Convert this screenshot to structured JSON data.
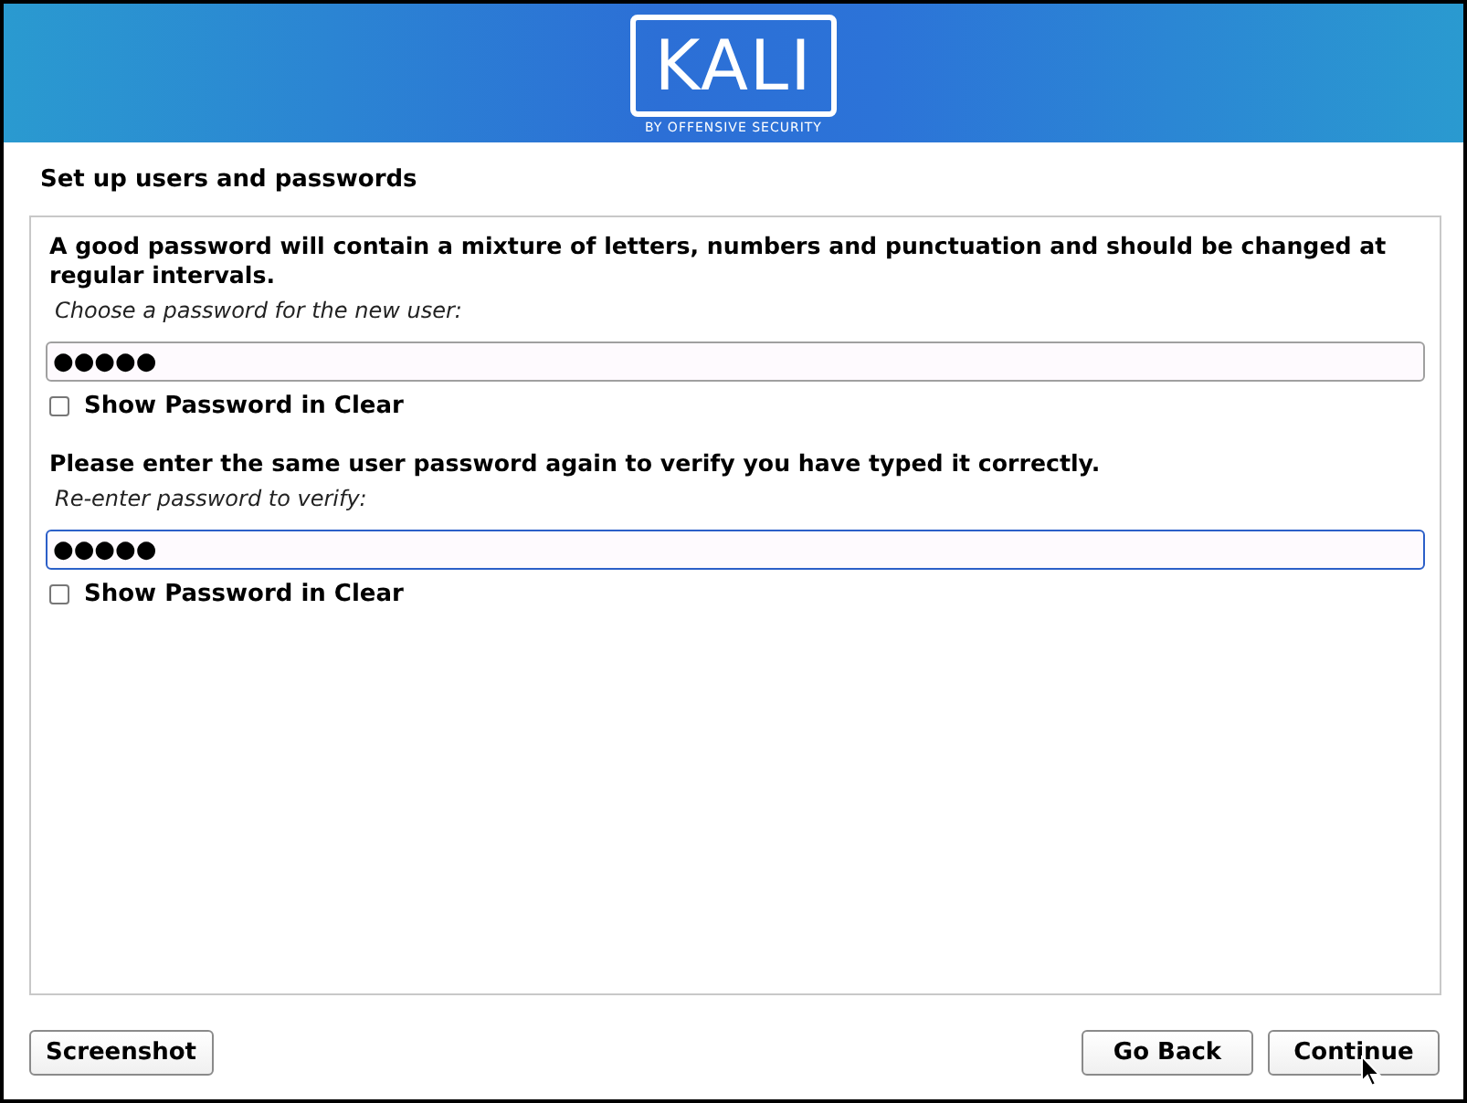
{
  "header": {
    "logo_text": "KALI",
    "logo_tagline": "BY OFFENSIVE SECURITY"
  },
  "page_title": "Set up users and passwords",
  "sections": [
    {
      "description": "A good password will contain a mixture of letters, numbers and punctuation and should be changed at regular intervals.",
      "prompt": "Choose a password for the new user:",
      "value": "●●●●●",
      "focused": false,
      "show_clear": {
        "label": "Show Password in Clear",
        "checked": false
      }
    },
    {
      "description": "Please enter the same user password again to verify you have typed it correctly.",
      "prompt": "Re-enter password to verify:",
      "value": "●●●●●",
      "focused": true,
      "show_clear": {
        "label": "Show Password in Clear",
        "checked": false
      }
    }
  ],
  "left_buttons": [
    "Screenshot"
  ],
  "right_buttons": [
    "Go Back",
    "Continue"
  ]
}
